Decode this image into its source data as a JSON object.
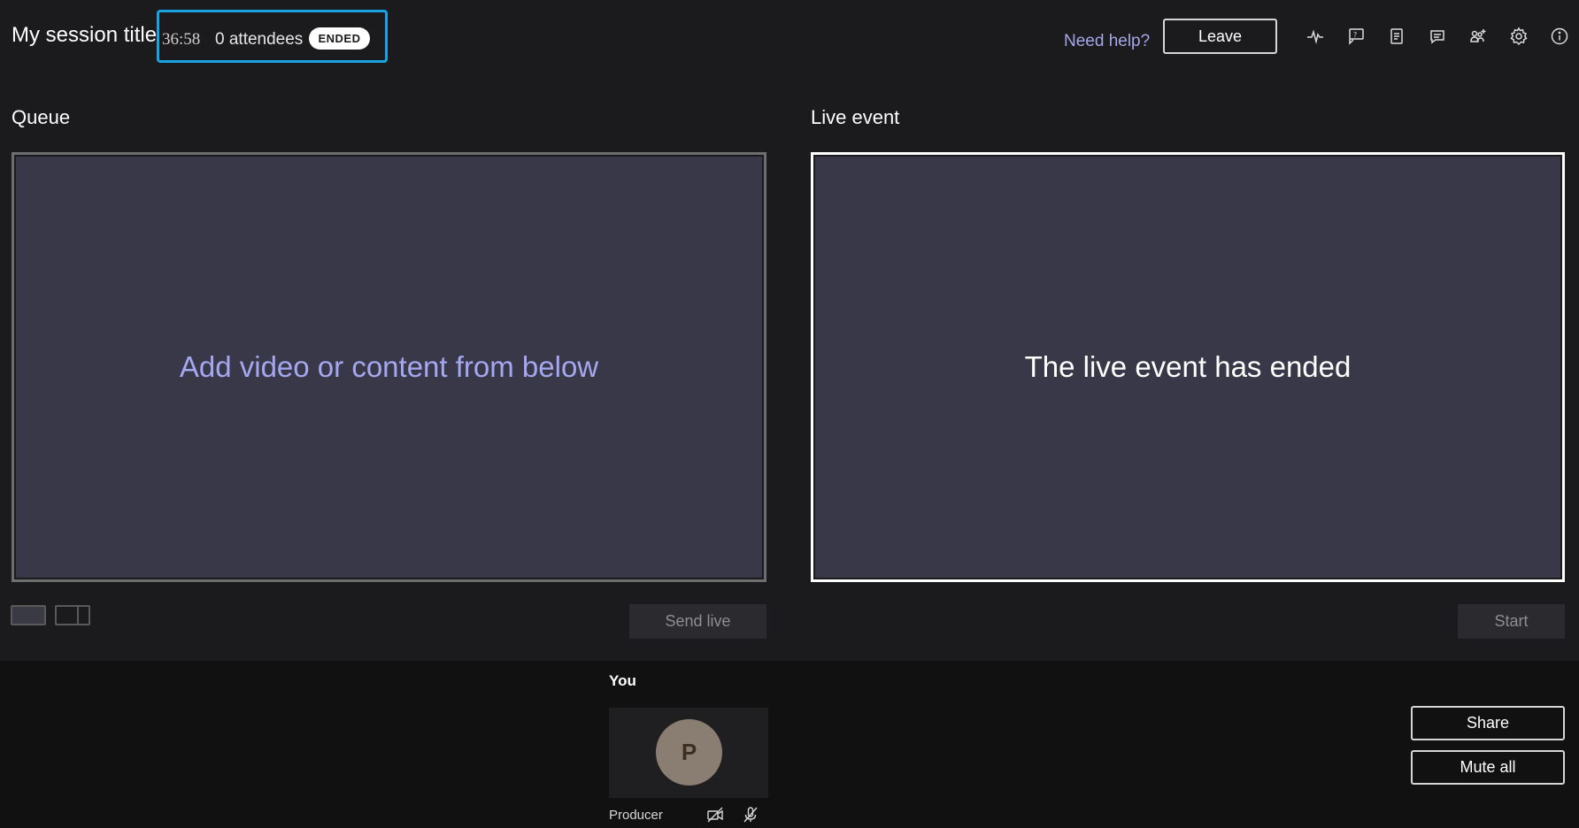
{
  "header": {
    "session_title": "My session title",
    "timer": "36:58",
    "attendees": "0 attendees",
    "status_badge": "ENDED",
    "need_help": "Need help?",
    "leave_label": "Leave",
    "icons": [
      "health-icon",
      "qa-icon",
      "meeting-notes-icon",
      "chat-icon",
      "invite-people-icon",
      "settings-icon",
      "info-icon"
    ]
  },
  "queue": {
    "label": "Queue",
    "message": "Add video or content from below",
    "send_live_label": "Send live"
  },
  "live": {
    "label": "Live event",
    "message": "The live event has ended",
    "start_label": "Start"
  },
  "bottom": {
    "you_label": "You",
    "avatar_initial": "P",
    "participant_name": "Producer",
    "share_label": "Share",
    "mute_all_label": "Mute all"
  },
  "colors": {
    "accent_outline": "#1aa3e0",
    "queue_message": "#a5a7f0",
    "link": "#a5a7e8",
    "panel_bg": "#393849"
  }
}
